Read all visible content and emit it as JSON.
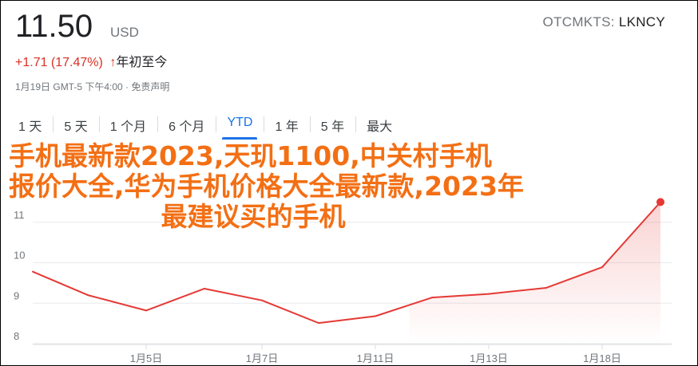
{
  "quote": {
    "price": "11.50",
    "currency": "USD",
    "exchange": "OTCMKTS: ",
    "symbol": "LKNCY",
    "change": "+1.71 (17.47%)",
    "change_arrow": "↑",
    "change_period": "年初至今",
    "timestamp": "1月19日 GMT-5 下午4:00 · 免责声明"
  },
  "range_tabs": [
    {
      "label": "1 天"
    },
    {
      "label": "5 天"
    },
    {
      "label": "1 个月"
    },
    {
      "label": "6 个月"
    },
    {
      "label": "YTD",
      "active": true
    },
    {
      "label": "1 年"
    },
    {
      "label": "5 年"
    },
    {
      "label": "最大"
    }
  ],
  "overlay_text": {
    "line1": "手机最新款2023,天玑1100,中关村手机",
    "line2": "报价大全,华为手机价格大全最新款,2023年",
    "line3": "最建议买的手机"
  },
  "colors": {
    "line": "#e53935",
    "negative": "#d93025",
    "accent": "#1a73e8",
    "overlay_text": "#f36f14"
  },
  "chart_data": {
    "type": "area",
    "x": [
      "1月3日",
      "1月4日",
      "1月5日",
      "1月6日",
      "1月7日",
      "1月10日",
      "1月11日",
      "1月12日",
      "1月13日",
      "1月14日",
      "1月18日",
      "1月19日"
    ],
    "y": [
      9.78,
      9.2,
      8.82,
      9.36,
      9.07,
      8.51,
      8.68,
      9.14,
      9.23,
      9.38,
      9.89,
      11.5
    ],
    "xticks": [
      "1月5日",
      "1月7日",
      "1月11日",
      "1月13日",
      "1月18日"
    ],
    "yticks": [
      8,
      9,
      10,
      11
    ],
    "ylim": [
      8,
      12
    ],
    "grid": true
  }
}
